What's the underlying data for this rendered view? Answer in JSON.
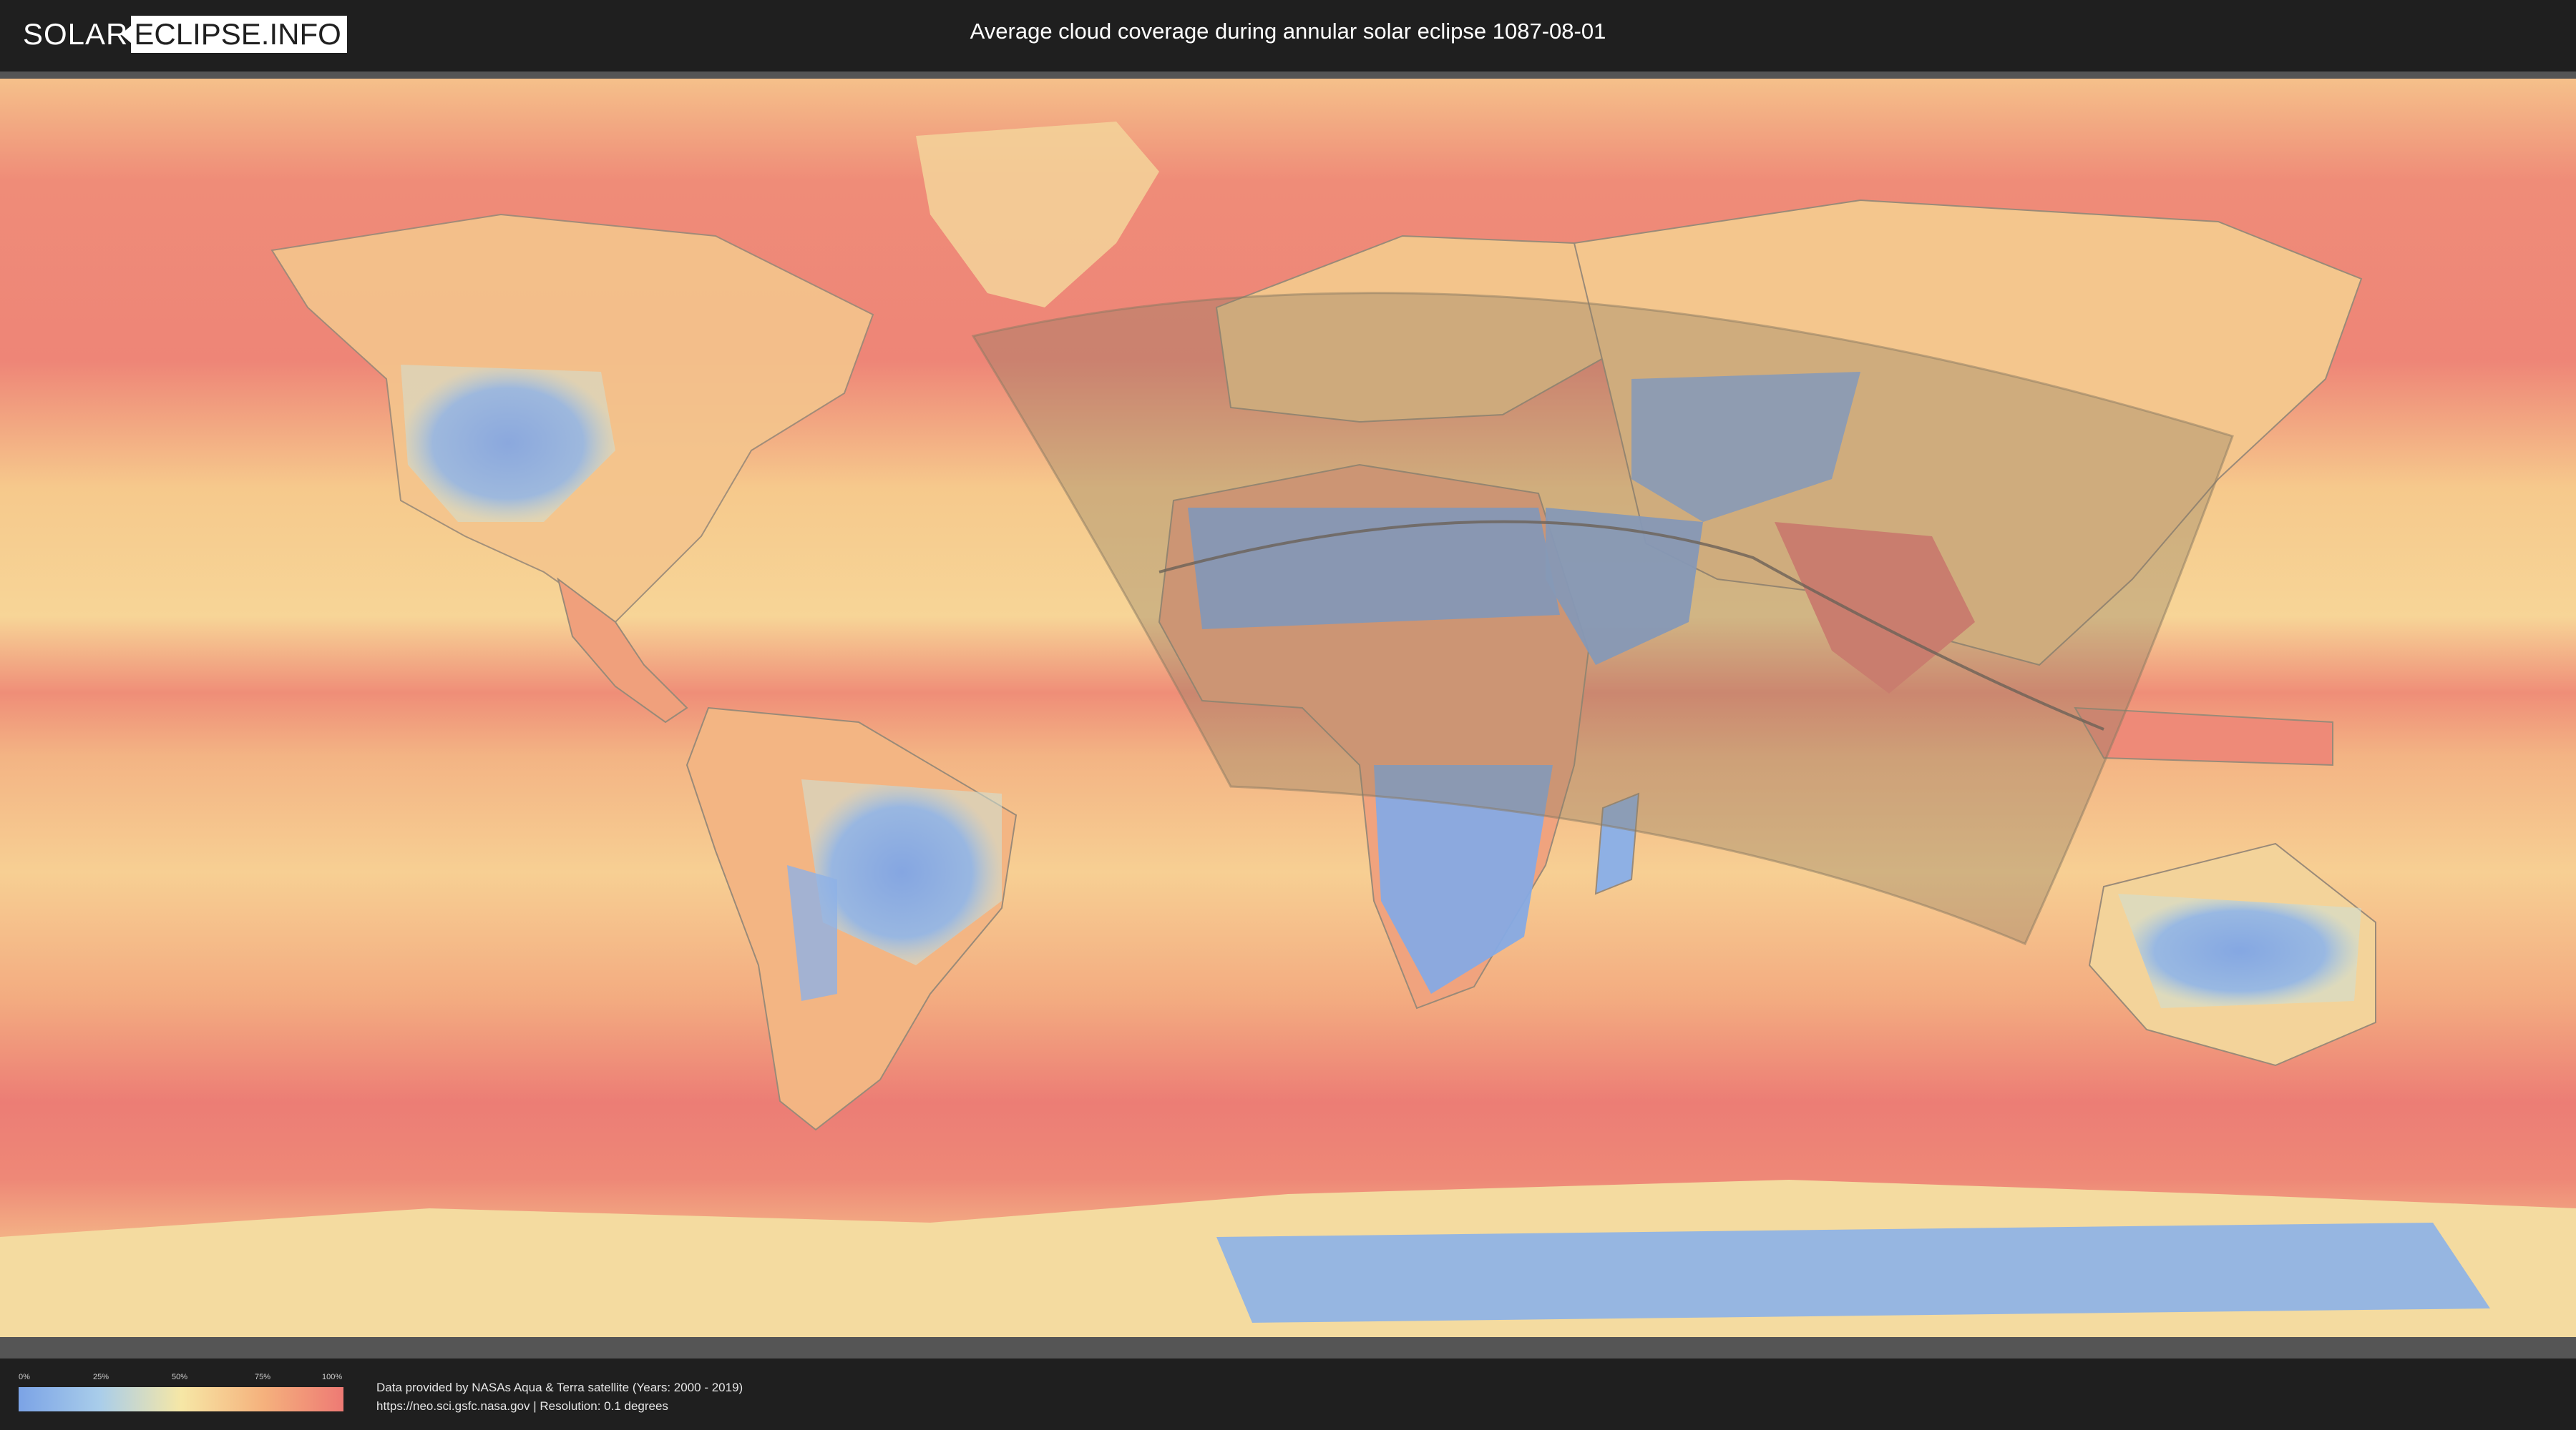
{
  "header": {
    "logo_solar": "SOLAR",
    "logo_eclipse": "ECLIPSE.INFO",
    "title": "Average cloud coverage during annular solar eclipse 1087-08-01"
  },
  "legend": {
    "ticks": [
      "0%",
      "25%",
      "50%",
      "75%",
      "100%"
    ],
    "colors": [
      "#7ba3e6",
      "#a9cdea",
      "#f6e7a6",
      "#f5b27d",
      "#ee7a74"
    ]
  },
  "footer": {
    "line1": "Data provided by NASAs Aqua & Terra satellite (Years: 2000 - 2019)",
    "line2": "https://neo.sci.gsfc.nasa.gov | Resolution: 0.1 degrees"
  },
  "map": {
    "projection": "equirectangular",
    "eclipse_path": "central line of annular eclipse",
    "visibility_zone": "shaded area of partial eclipse visibility",
    "colors": {
      "ocean_cloudy": "#ef8a78",
      "ocean_mid": "#f6c589",
      "clear": "#86a9e3",
      "zone_shade": "#8a7a62"
    }
  }
}
